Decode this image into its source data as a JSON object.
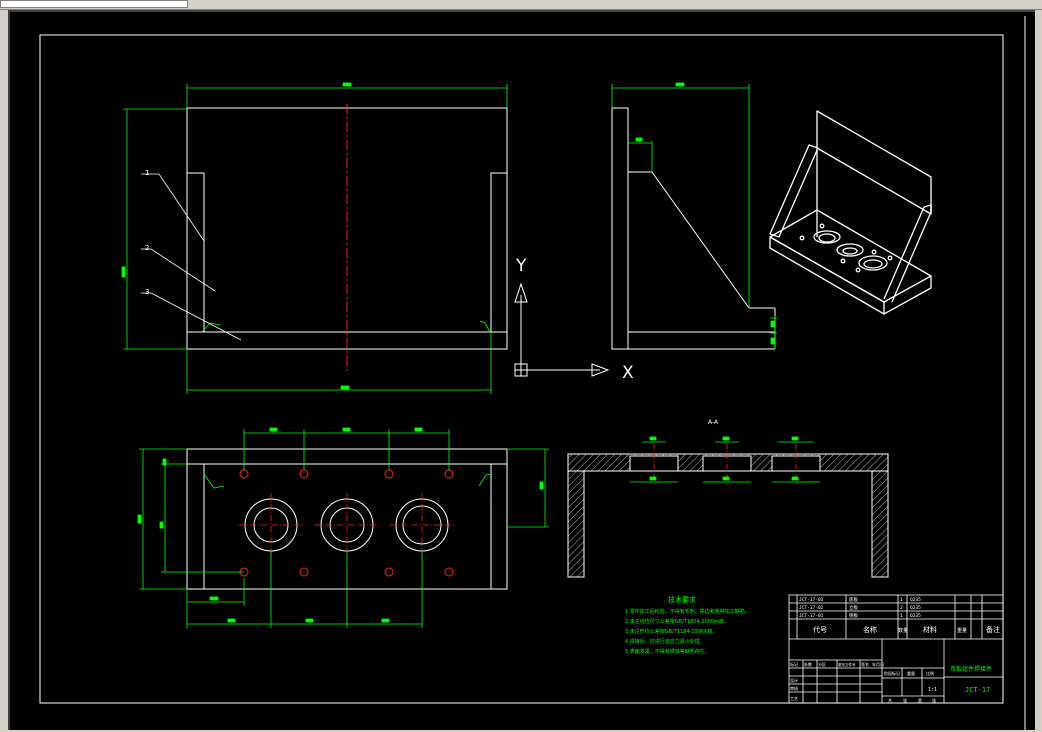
{
  "colors": {
    "background": "#000000",
    "outline": "#ffffff",
    "dimension": "#00ff00",
    "centerline": "#ff0000",
    "note_text": "#00ff00",
    "title_text": "#00ff00"
  },
  "ucs": {
    "y_label": "Y",
    "x_label": "X"
  },
  "front_view": {
    "callouts": [
      "1",
      "2",
      "3"
    ]
  },
  "section_view": {
    "label": "A-A"
  },
  "notes": {
    "title": "技术要求",
    "lines": [
      "1.零件加工后检验，不得有毛刺、锐边和各种加工缺陷。",
      "2.未注线性尺寸公差按GB/T1804-2000m级。",
      "3.未注形位公差按GB/T1184-1996K级。",
      "4.焊接后，应进行去应力退火处理。",
      "5.表面发黑，不得有锈蚀等缺陷存在。"
    ]
  },
  "title_block": {
    "part_rows": [
      {
        "code": "JCT-17-03",
        "name": "底板",
        "qty": "1",
        "material": "Q235"
      },
      {
        "code": "JCT-17-02",
        "name": "立板",
        "qty": "2",
        "material": "Q235"
      },
      {
        "code": "JCT-17-01",
        "name": "侧板",
        "qty": "1",
        "material": "Q235"
      }
    ],
    "header": {
      "code": "代号",
      "name": "名称",
      "qty": "数量",
      "material": "材料",
      "weight": "重量",
      "remark": "备注"
    },
    "drawing_title": "弯板组件焊接件",
    "drawing_number": "JCT-17",
    "scale": "1:1",
    "row_labels": [
      "标记",
      "处数",
      "分区",
      "更改文件号",
      "签名",
      "年月日"
    ],
    "stage_labels": [
      "阶段标记",
      "重量",
      "比例"
    ],
    "sign_labels": [
      "设计",
      "审核",
      "工艺"
    ],
    "sheet_labels": [
      "共",
      "张",
      "第",
      "张"
    ]
  }
}
